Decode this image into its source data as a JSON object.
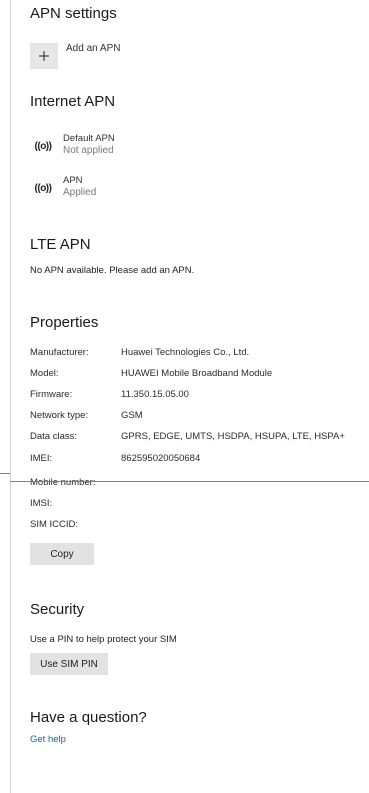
{
  "apn_settings": {
    "title": "APN settings",
    "add_label": "Add an APN",
    "add_icon": "plus-icon"
  },
  "internet_apn": {
    "title": "Internet APN",
    "items": [
      {
        "name": "Default APN",
        "status": "Not applied",
        "icon": "((o))"
      },
      {
        "name": "APN",
        "status": "Applied",
        "icon": "((o))"
      }
    ]
  },
  "lte_apn": {
    "title": "LTE APN",
    "note": "No APN available. Please add an APN."
  },
  "properties": {
    "title": "Properties",
    "rows": [
      {
        "key": "Manufacturer:",
        "value": "Huawei Technologies Co., Ltd."
      },
      {
        "key": "Model:",
        "value": "HUAWEI Mobile Broadband Module"
      },
      {
        "key": "Firmware:",
        "value": "11.350.15.05.00"
      },
      {
        "key": "Network type:",
        "value": "GSM"
      },
      {
        "key": "Data class:",
        "value": "GPRS, EDGE, UMTS, HSDPA, HSUPA, LTE, HSPA+"
      },
      {
        "key": "IMEI:",
        "value": "862595020050684"
      },
      {
        "key": "Mobile number:",
        "value": ""
      },
      {
        "key": "IMSI:",
        "value": ""
      },
      {
        "key": "SIM ICCID:",
        "value": ""
      }
    ],
    "copy_label": "Copy"
  },
  "security": {
    "title": "Security",
    "note": "Use a PIN to help protect your SIM",
    "button_label": "Use SIM PIN"
  },
  "help": {
    "title": "Have a question?",
    "link": "Get help"
  },
  "colors": {
    "accent_link": "#0a66b8",
    "divider_line": "#4a90c8",
    "marker": "#36b04a",
    "button_bg": "#e2e2e2"
  }
}
